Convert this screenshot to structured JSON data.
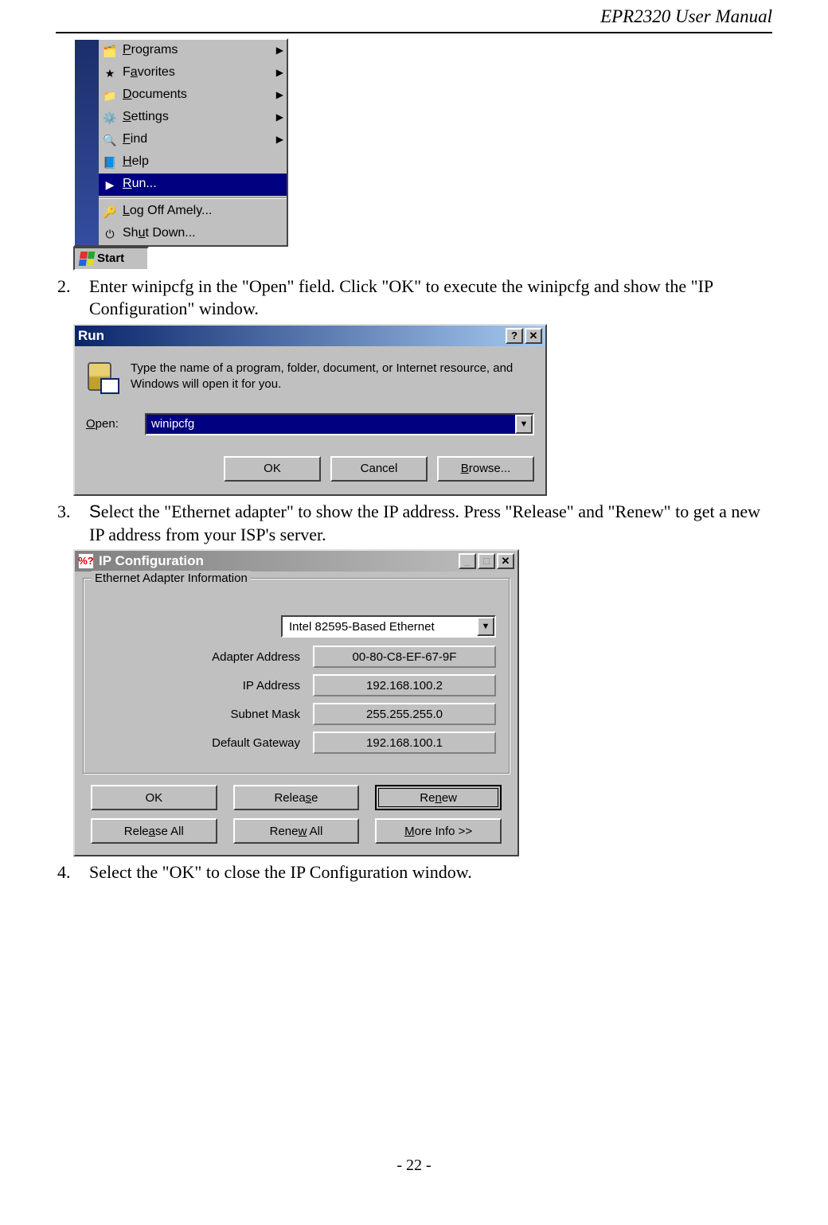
{
  "header": {
    "title": "EPR2320 User Manual"
  },
  "startmenu": {
    "items": [
      {
        "icon": "programs-icon",
        "label_pre": "",
        "hotkey": "P",
        "label_post": "rograms",
        "has_arrow": true,
        "selected": false
      },
      {
        "icon": "favorites-icon",
        "label_pre": "F",
        "hotkey": "a",
        "label_post": "vorites",
        "has_arrow": true,
        "selected": false
      },
      {
        "icon": "documents-icon",
        "label_pre": "",
        "hotkey": "D",
        "label_post": "ocuments",
        "has_arrow": true,
        "selected": false
      },
      {
        "icon": "settings-icon",
        "label_pre": "",
        "hotkey": "S",
        "label_post": "ettings",
        "has_arrow": true,
        "selected": false
      },
      {
        "icon": "find-icon",
        "label_pre": "",
        "hotkey": "F",
        "label_post": "ind",
        "has_arrow": true,
        "selected": false
      },
      {
        "icon": "help-icon",
        "label_pre": "",
        "hotkey": "H",
        "label_post": "elp",
        "has_arrow": false,
        "selected": false
      },
      {
        "icon": "run-icon",
        "label_pre": "",
        "hotkey": "R",
        "label_post": "un...",
        "has_arrow": false,
        "selected": true
      }
    ],
    "after_separator": [
      {
        "icon": "logoff-icon",
        "label_pre": "",
        "hotkey": "L",
        "label_post": "og Off Amely...",
        "has_arrow": false
      },
      {
        "icon": "shutdown-icon",
        "label_pre": "Sh",
        "hotkey": "u",
        "label_post": "t Down...",
        "has_arrow": false
      }
    ],
    "start_label": "Start"
  },
  "steps": {
    "s2_num": "2.",
    "s2_text": "Enter winipcfg in the \"Open\" field. Click \"OK\" to execute the winipcfg and show the \"IP Configuration\" window.",
    "s3_num": "3.",
    "s3_text": "Select the \"Ethernet adapter\" to show the IP address. Press \"Release\" and \"Renew\" to get a new IP address from your ISP's server.",
    "s4_num": "4.",
    "s4_text": "Select the \"OK\" to close the IP Configuration window."
  },
  "run": {
    "title": "Run",
    "help_btn": "?",
    "close_btn": "✕",
    "description": "Type the name of a program, folder, document, or Internet resource, and Windows will open it for you.",
    "open_label_pre": "",
    "open_hotkey": "O",
    "open_label_post": "pen:",
    "open_value": "winipcfg",
    "ok": "OK",
    "cancel": "Cancel",
    "browse_pre": "",
    "browse_hotkey": "B",
    "browse_post": "rowse..."
  },
  "ipcfg": {
    "title": "IP Configuration",
    "groupbox": "Ethernet Adapter Information",
    "adapter_value": "Intel 82595-Based Ethernet",
    "rows": {
      "adapter_address_label": "Adapter Address",
      "adapter_address_value": "00-80-C8-EF-67-9F",
      "ip_address_label": "IP Address",
      "ip_address_value": "192.168.100.2",
      "subnet_mask_label": "Subnet Mask",
      "subnet_mask_value": "255.255.255.0",
      "default_gateway_label": "Default Gateway",
      "default_gateway_value": "192.168.100.1"
    },
    "buttons": {
      "ok": "OK",
      "release_pre": "Relea",
      "release_hot": "s",
      "release_post": "e",
      "renew_pre": "Re",
      "renew_hot": "n",
      "renew_post": "ew",
      "release_all_pre": "Rele",
      "release_all_hot": "a",
      "release_all_post": "se All",
      "renew_all_pre": "Rene",
      "renew_all_hot": "w",
      "renew_all_post": " All",
      "more_pre": "",
      "more_hot": "M",
      "more_post": "ore Info >>"
    }
  },
  "footer": {
    "page": "- 22 -"
  }
}
